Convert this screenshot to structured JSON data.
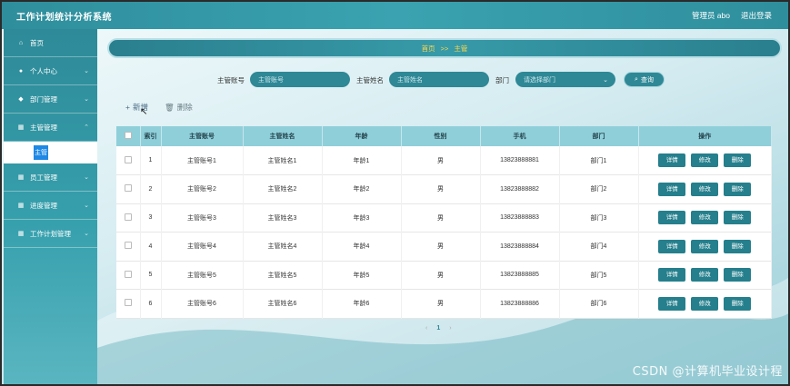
{
  "app": {
    "title": "工作计划统计分析系统"
  },
  "topbar": {
    "user": "管理员 abo",
    "logout": "退出登录"
  },
  "sidebar": {
    "items": [
      {
        "icon": "home-icon",
        "label": "首页",
        "chev": false
      },
      {
        "icon": "user-icon",
        "label": "个人中心",
        "chev": true
      },
      {
        "icon": "pin-icon",
        "label": "部门管理",
        "chev": true
      },
      {
        "icon": "grid-icon",
        "label": "主管管理",
        "chev": true
      },
      {
        "icon": "grid-icon",
        "label": "员工管理",
        "chev": true
      },
      {
        "icon": "grid-icon",
        "label": "进度管理",
        "chev": true
      },
      {
        "icon": "grid-icon",
        "label": "工作计划管理",
        "chev": true
      }
    ],
    "sub_active": "主管"
  },
  "breadcrumb": {
    "home": "首页",
    "sep": ">>",
    "current": "主管"
  },
  "search": {
    "account_label": "主管账号",
    "account_placeholder": "主管账号",
    "name_label": "主管姓名",
    "name_placeholder": "主管姓名",
    "dept_label": "部门",
    "dept_placeholder": "请选择部门",
    "button": "查询"
  },
  "actions": {
    "add": "新增",
    "delete": "删除"
  },
  "table": {
    "headers": [
      "索引",
      "主管账号",
      "主管姓名",
      "年龄",
      "性别",
      "手机",
      "部门",
      "操作"
    ],
    "rows": [
      {
        "idx": "1",
        "account": "主管账号1",
        "name": "主管姓名1",
        "age": "年龄1",
        "gender": "男",
        "phone": "13823888881",
        "dept": "部门1"
      },
      {
        "idx": "2",
        "account": "主管账号2",
        "name": "主管姓名2",
        "age": "年龄2",
        "gender": "男",
        "phone": "13823888882",
        "dept": "部门2"
      },
      {
        "idx": "3",
        "account": "主管账号3",
        "name": "主管姓名3",
        "age": "年龄3",
        "gender": "男",
        "phone": "13823888883",
        "dept": "部门3"
      },
      {
        "idx": "4",
        "account": "主管账号4",
        "name": "主管姓名4",
        "age": "年龄4",
        "gender": "男",
        "phone": "13823888884",
        "dept": "部门4"
      },
      {
        "idx": "5",
        "account": "主管账号5",
        "name": "主管姓名5",
        "age": "年龄5",
        "gender": "男",
        "phone": "13823888885",
        "dept": "部门5"
      },
      {
        "idx": "6",
        "account": "主管账号6",
        "name": "主管姓名6",
        "age": "年龄6",
        "gender": "男",
        "phone": "13823888886",
        "dept": "部门6"
      }
    ],
    "op_detail": "详情",
    "op_edit": "修改",
    "op_delete": "删除"
  },
  "pager": {
    "prev": "‹",
    "current": "1",
    "next": "›"
  },
  "watermark": "CSDN @计算机毕业设计程",
  "colors": {
    "accent": "#2f8896",
    "header": "#8fcfda",
    "active": "#1e88e5",
    "breadcrumb_text": "#ffd84a"
  }
}
